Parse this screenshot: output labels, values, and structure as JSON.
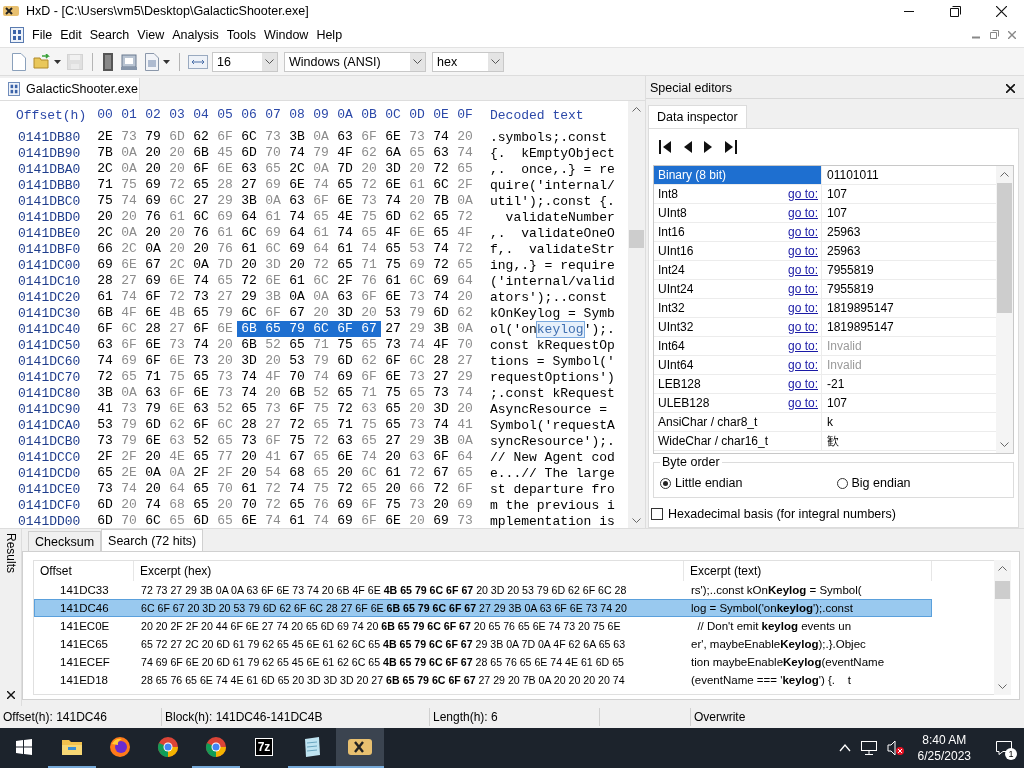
{
  "window": {
    "title": "HxD - [C:\\Users\\vm5\\Desktop\\GalacticShooter.exe]"
  },
  "menu": [
    "File",
    "Edit",
    "Search",
    "View",
    "Analysis",
    "Tools",
    "Window",
    "Help"
  ],
  "toolbar": {
    "buttons": [
      {
        "kind": "new",
        "disabled": false,
        "dropdown": false
      },
      {
        "kind": "open",
        "disabled": false,
        "dropdown": true
      },
      {
        "kind": "save",
        "disabled": true,
        "dropdown": false
      },
      {
        "kind": "memory",
        "disabled": false,
        "dropdown": false
      },
      {
        "kind": "disk",
        "disabled": false,
        "dropdown": false
      },
      {
        "kind": "image",
        "disabled": false,
        "dropdown": true
      }
    ],
    "bytes_per_row": "16",
    "encoding": "Windows (ANSI)",
    "offset_base": "hex"
  },
  "document_tab": {
    "label": "GalacticShooter.exe"
  },
  "hex_view": {
    "offset_header": "Offset(h)",
    "columns": [
      "00",
      "01",
      "02",
      "03",
      "04",
      "05",
      "06",
      "07",
      "08",
      "09",
      "0A",
      "0B",
      "0C",
      "0D",
      "0E",
      "0F"
    ],
    "text_header": "Decoded text",
    "rows": [
      {
        "offset": "0141DB80",
        "segments": [
          {
            "bytes": "2E 73 79 6D 62 6F 6C 73 3B 0A 63 6F 6E 73 74 20",
            "text": ".symbols;.const ",
            "selected": false
          }
        ]
      },
      {
        "offset": "0141DB90",
        "segments": [
          {
            "bytes": "7B 0A 20 20 6B 45 6D 70 74 79 4F 62 6A 65 63 74",
            "text": "{.  kEmptyObject",
            "selected": false
          }
        ]
      },
      {
        "offset": "0141DBA0",
        "segments": [
          {
            "bytes": "2C 0A 20 20 6F 6E 63 65 2C 0A 7D 20 3D 20 72 65",
            "text": ",.  once,.} = re",
            "selected": false
          }
        ]
      },
      {
        "offset": "0141DBB0",
        "segments": [
          {
            "bytes": "71 75 69 72 65 28 27 69 6E 74 65 72 6E 61 6C 2F",
            "text": "quire('internal/",
            "selected": false
          }
        ]
      },
      {
        "offset": "0141DBC0",
        "segments": [
          {
            "bytes": "75 74 69 6C 27 29 3B 0A 63 6F 6E 73 74 20 7B 0A",
            "text": "util');.const {.",
            "selected": false
          }
        ]
      },
      {
        "offset": "0141DBD0",
        "segments": [
          {
            "bytes": "20 20 76 61 6C 69 64 61 74 65 4E 75 6D 62 65 72",
            "text": "  validateNumber",
            "selected": false
          }
        ]
      },
      {
        "offset": "0141DBE0",
        "segments": [
          {
            "bytes": "2C 0A 20 20 76 61 6C 69 64 61 74 65 4F 6E 65 4F",
            "text": ",.  validateOneO",
            "selected": false
          }
        ]
      },
      {
        "offset": "0141DBF0",
        "segments": [
          {
            "bytes": "66 2C 0A 20 20 76 61 6C 69 64 61 74 65 53 74 72",
            "text": "f,.  validateStr",
            "selected": false
          }
        ]
      },
      {
        "offset": "0141DC00",
        "segments": [
          {
            "bytes": "69 6E 67 2C 0A 7D 20 3D 20 72 65 71 75 69 72 65",
            "text": "ing,.} = require",
            "selected": false
          }
        ]
      },
      {
        "offset": "0141DC10",
        "segments": [
          {
            "bytes": "28 27 69 6E 74 65 72 6E 61 6C 2F 76 61 6C 69 64",
            "text": "('internal/valid",
            "selected": false
          }
        ]
      },
      {
        "offset": "0141DC20",
        "segments": [
          {
            "bytes": "61 74 6F 72 73 27 29 3B 0A 0A 63 6F 6E 73 74 20",
            "text": "ators');..const ",
            "selected": false
          }
        ]
      },
      {
        "offset": "0141DC30",
        "segments": [
          {
            "bytes": "6B 4F 6E 4B 65 79 6C 6F 67 20 3D 20 53 79 6D 62",
            "text": "kOnKeylog = Symb",
            "selected": false
          }
        ]
      },
      {
        "offset": "0141DC40",
        "segments": [
          {
            "bytes": "6F 6C 28 27 6F 6E",
            "text": "ol('on",
            "selected": false
          },
          {
            "bytes": "6B 65 79 6C 6F 67",
            "text": "keylog",
            "selected": true
          },
          {
            "bytes": "27 29 3B 0A",
            "text": "');.",
            "selected": false
          }
        ]
      },
      {
        "offset": "0141DC50",
        "segments": [
          {
            "bytes": "63 6F 6E 73 74 20 6B 52 65 71 75 65 73 74 4F 70",
            "text": "const kRequestOp",
            "selected": false
          }
        ]
      },
      {
        "offset": "0141DC60",
        "segments": [
          {
            "bytes": "74 69 6F 6E 73 20 3D 20 53 79 6D 62 6F 6C 28 27",
            "text": "tions = Symbol('",
            "selected": false
          }
        ]
      },
      {
        "offset": "0141DC70",
        "segments": [
          {
            "bytes": "72 65 71 75 65 73 74 4F 70 74 69 6F 6E 73 27 29",
            "text": "requestOptions')",
            "selected": false
          }
        ]
      },
      {
        "offset": "0141DC80",
        "segments": [
          {
            "bytes": "3B 0A 63 6F 6E 73 74 20 6B 52 65 71 75 65 73 74",
            "text": ";.const kRequest",
            "selected": false
          }
        ]
      },
      {
        "offset": "0141DC90",
        "segments": [
          {
            "bytes": "41 73 79 6E 63 52 65 73 6F 75 72 63 65 20 3D 20",
            "text": "AsyncResource = ",
            "selected": false
          }
        ]
      },
      {
        "offset": "0141DCA0",
        "segments": [
          {
            "bytes": "53 79 6D 62 6F 6C 28 27 72 65 71 75 65 73 74 41",
            "text": "Symbol('requestA",
            "selected": false
          }
        ]
      },
      {
        "offset": "0141DCB0",
        "segments": [
          {
            "bytes": "73 79 6E 63 52 65 73 6F 75 72 63 65 27 29 3B 0A",
            "text": "syncResource');.",
            "selected": false
          }
        ]
      },
      {
        "offset": "0141DCC0",
        "segments": [
          {
            "bytes": "2F 2F 20 4E 65 77 20 41 67 65 6E 74 20 63 6F 64",
            "text": "// New Agent cod",
            "selected": false
          }
        ]
      },
      {
        "offset": "0141DCD0",
        "segments": [
          {
            "bytes": "65 2E 0A 0A 2F 2F 20 54 68 65 20 6C 61 72 67 65",
            "text": "e...// The large",
            "selected": false
          }
        ]
      },
      {
        "offset": "0141DCE0",
        "segments": [
          {
            "bytes": "73 74 20 64 65 70 61 72 74 75 72 65 20 66 72 6F",
            "text": "st departure fro",
            "selected": false
          }
        ]
      },
      {
        "offset": "0141DCF0",
        "segments": [
          {
            "bytes": "6D 20 74 68 65 20 70 72 65 76 69 6F 75 73 20 69",
            "text": "m the previous i",
            "selected": false
          }
        ]
      },
      {
        "offset": "0141DD00",
        "segments": [
          {
            "bytes": "6D 70 6C 65 6D 65 6E 74 61 74 69 6F 6E 20 69 73",
            "text": "mplementation is",
            "selected": false
          }
        ]
      }
    ]
  },
  "special_editors": {
    "title": "Special editors",
    "tab": "Data inspector",
    "rows": [
      {
        "name": "Binary (8 bit)",
        "value": "01101011",
        "disabled": false,
        "selected": true
      },
      {
        "name": "Int8",
        "link": "go to:",
        "value": "107",
        "disabled": false,
        "selected": false
      },
      {
        "name": "UInt8",
        "link": "go to:",
        "value": "107",
        "disabled": false,
        "selected": false
      },
      {
        "name": "Int16",
        "link": "go to:",
        "value": "25963",
        "disabled": false,
        "selected": false
      },
      {
        "name": "UInt16",
        "link": "go to:",
        "value": "25963",
        "disabled": false,
        "selected": false
      },
      {
        "name": "Int24",
        "link": "go to:",
        "value": "7955819",
        "disabled": false,
        "selected": false
      },
      {
        "name": "UInt24",
        "link": "go to:",
        "value": "7955819",
        "disabled": false,
        "selected": false
      },
      {
        "name": "Int32",
        "link": "go to:",
        "value": "1819895147",
        "disabled": false,
        "selected": false
      },
      {
        "name": "UInt32",
        "link": "go to:",
        "value": "1819895147",
        "disabled": false,
        "selected": false
      },
      {
        "name": "Int64",
        "link": "go to:",
        "value": "Invalid",
        "disabled": true,
        "selected": false
      },
      {
        "name": "UInt64",
        "link": "go to:",
        "value": "Invalid",
        "disabled": true,
        "selected": false
      },
      {
        "name": "LEB128",
        "link": "go to:",
        "value": "-21",
        "disabled": false,
        "selected": false
      },
      {
        "name": "ULEB128",
        "link": "go to:",
        "value": "107",
        "disabled": false,
        "selected": false
      },
      {
        "name": "AnsiChar / char8_t",
        "value": "k",
        "disabled": false,
        "selected": false
      },
      {
        "name": "WideChar / char16_t",
        "value": "歓",
        "disabled": false,
        "selected": false
      }
    ],
    "byte_order": {
      "title": "Byte order",
      "options": [
        {
          "label": "Little endian",
          "selected": true
        },
        {
          "label": "Big endian",
          "selected": false
        }
      ]
    },
    "hex_basis": {
      "label": "Hexadecimal basis (for integral numbers)",
      "checked": false
    }
  },
  "results": {
    "title": "Results",
    "tabs": [
      {
        "label": "Checksum",
        "selected": false
      },
      {
        "label": "Search (72 hits)",
        "selected": true
      }
    ],
    "columns": [
      "Offset",
      "Excerpt (hex)",
      "Excerpt (text)"
    ],
    "rows": [
      {
        "offset": "141DC33",
        "hex": "72 73 27 29 3B 0A 0A 63 6F 6E 73 74 20 6B 4F 6E **4B 65 79 6C 6F 67** 20 3D 20 53 79 6D 62 6F 6C 28",
        "text": "rs');..const kOn**Keylog** = Symbol(",
        "selected": false
      },
      {
        "offset": "141DC46",
        "hex": "6C 6F 67 20 3D 20 53 79 6D 62 6F 6C 28 27 6F 6E **6B 65 79 6C 6F 67** 27 29 3B 0A 63 6F 6E 73 74 20",
        "text": "log = Symbol('on**keylog**');.const",
        "selected": true
      },
      {
        "offset": "141EC0E",
        "hex": "20 20 2F 2F 20 44 6F 6E 27 74 20 65 6D 69 74 20 **6B 65 79 6C 6F 67** 20 65 76 65 6E 74 73 20 75 6E",
        "text": "  // Don't emit **keylog** events un",
        "selected": false
      },
      {
        "offset": "141EC65",
        "hex": "65 72 27 2C 20 6D 61 79 62 65 45 6E 61 62 6C 65 **4B 65 79 6C 6F 67** 29 3B 0A 7D 0A 4F 62 6A 65 63",
        "text": "er', maybeEnable**Keylog**);.}.Objec",
        "selected": false
      },
      {
        "offset": "141ECEF",
        "hex": "74 69 6F 6E 20 6D 61 79 62 65 45 6E 61 62 6C 65 **4B 65 79 6C 6F 67** 28 65 76 65 6E 74 4E 61 6D 65",
        "text": "tion maybeEnable**Keylog**(eventName",
        "selected": false
      },
      {
        "offset": "141ED18",
        "hex": "28 65 76 65 6E 74 4E 61 6D 65 20 3D 3D 3D 20 27 **6B 65 79 6C 6F 67** 27 29 20 7B 0A 20 20 20 20 74",
        "text": "(eventName === '**keylog**') {.    t",
        "selected": false
      }
    ]
  },
  "status_bar": [
    "Offset(h): 141DC46",
    "Block(h): 141DC46-141DC4B",
    "Length(h): 6",
    "Overwrite"
  ],
  "taskbar": {
    "apps": [
      {
        "kind": "explorer",
        "running": true,
        "active": false
      },
      {
        "kind": "firefox",
        "running": false,
        "active": false
      },
      {
        "kind": "chrome",
        "running": false,
        "active": false
      },
      {
        "kind": "chrome",
        "running": true,
        "active": false
      },
      {
        "kind": "archiver",
        "label": "7z",
        "running": false,
        "active": false
      },
      {
        "kind": "notepad",
        "running": true,
        "active": false
      },
      {
        "kind": "hexeditor",
        "running": true,
        "active": true
      }
    ],
    "time": "8:40 AM",
    "date": "6/25/2023",
    "notifications": "1"
  }
}
